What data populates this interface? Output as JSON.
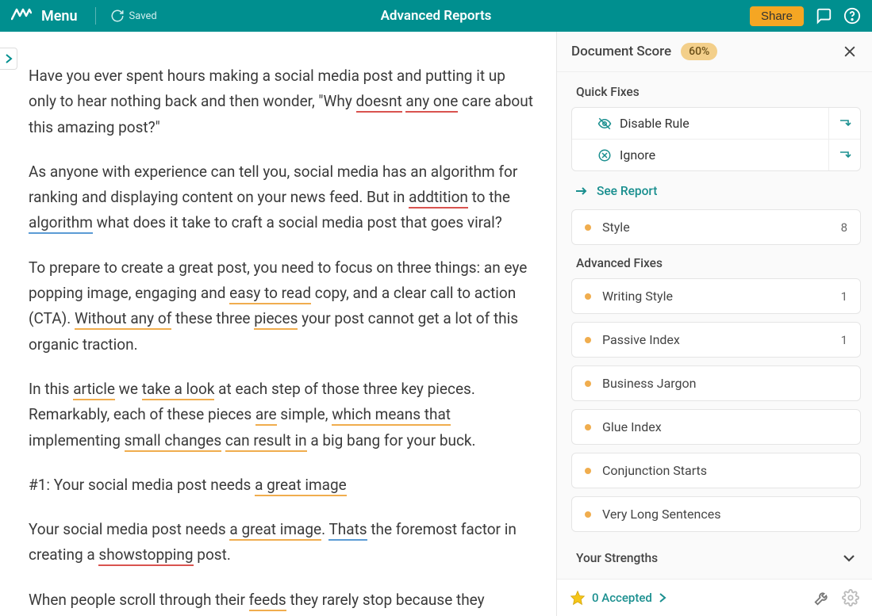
{
  "topbar": {
    "menu": "Menu",
    "saved": "Saved",
    "title": "Advanced Reports",
    "share": "Share"
  },
  "sidebar": {
    "header_title": "Document Score",
    "score": "60%",
    "quick_fixes_title": "Quick Fixes",
    "actions": {
      "disable_rule": "Disable Rule",
      "ignore": "Ignore"
    },
    "see_report": "See Report",
    "style_row": {
      "label": "Style",
      "count": "8"
    },
    "advanced_fixes_title": "Advanced Fixes",
    "categories": [
      {
        "label": "Writing Style",
        "count": "1"
      },
      {
        "label": "Passive Index",
        "count": "1"
      },
      {
        "label": "Business Jargon",
        "count": ""
      },
      {
        "label": "Glue Index",
        "count": ""
      },
      {
        "label": "Conjunction Starts",
        "count": ""
      },
      {
        "label": "Very Long Sentences",
        "count": ""
      }
    ],
    "strengths": "Your Strengths",
    "footer": {
      "accepted": "0 Accepted"
    }
  },
  "editor": {
    "p1_a": "Have you ever spent hours making a social media post and putting it up only to hear nothing back and then wonder, \"Why ",
    "p1_w1": "doesnt",
    "p1_b": " ",
    "p1_w2": "any one",
    "p1_c": " care about this amazing post?\"",
    "p2_a": "As anyone with experience can tell you, social media has an algorithm for ranking and displaying content on your news feed. But in ",
    "p2_w1": "addtition",
    "p2_b": " to the ",
    "p2_w2": "algorithm",
    "p2_c": " what does it take to craft a social media post that goes viral?",
    "p3_a": "To prepare to create a great post, you need to focus on three things: an eye popping image, engaging and ",
    "p3_w1": "easy to read",
    "p3_b": "  copy, and a clear call to action (CTA). ",
    "p3_w2": "Without any of",
    "p3_c": " these three ",
    "p3_w3": "pieces",
    "p3_d": " your post cannot get a lot of this organic traction.",
    "p4_a": "In this ",
    "p4_w1": "article",
    "p4_b": " we ",
    "p4_w2": "take a look",
    "p4_c": " at each step of those three key pieces. Remarkably, each of these pieces ",
    "p4_w3": "are",
    "p4_d": " simple, ",
    "p4_w4": "which means that",
    "p4_e": " implementing ",
    "p4_w5": "small changes",
    "p4_f": " ",
    "p4_w6": "can result in",
    "p4_g": " a big bang for your buck.",
    "p5_a": "#1: Your social media post needs ",
    "p5_w1": "a great image",
    "p6_a": "Your social media post needs ",
    "p6_w1": "a great image",
    "p6_b": ". ",
    "p6_w2": "Thats",
    "p6_c": " the foremost factor in creating a ",
    "p6_w3": "showstopping",
    "p6_d": " post.",
    "p7_a": "When people scroll through their ",
    "p7_w1": "feeds",
    "p7_b": " they rarely stop because they"
  }
}
